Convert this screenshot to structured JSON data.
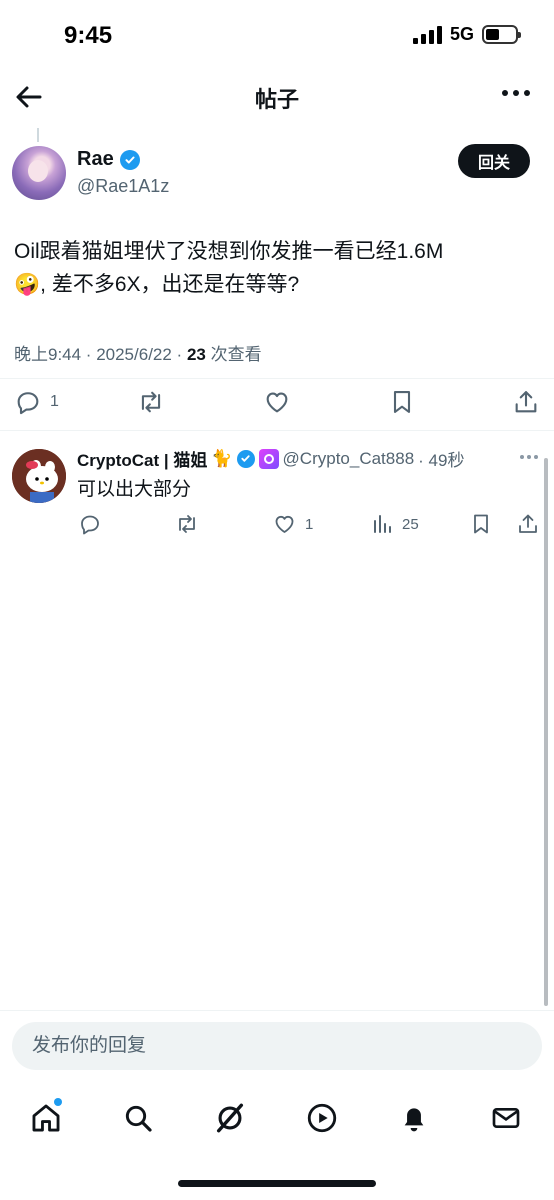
{
  "status_bar": {
    "time": "9:45",
    "network": "5G"
  },
  "header": {
    "title": "帖子",
    "back_icon": "back-arrow-icon",
    "more_icon": "more-horizontal-icon"
  },
  "post": {
    "author_name": "Rae",
    "author_handle": "@Rae1A1z",
    "follow_label": "回关",
    "text_line1": "Oil跟着猫姐埋伏了没想到你发推一看已经1.6M",
    "text_line2_emoji": "🤪",
    "text_line2": ", 差不多6X，出还是在等等?",
    "timestamp": "晚上9:44 · 2025/6/22 · ",
    "views_count": "23",
    "views_label": " 次查看",
    "reply_count": "1"
  },
  "reply": {
    "name": "CryptoCat | 猫姐",
    "name_emoji": "🐈",
    "handle": "@Crypto_Cat888",
    "time": "· 49秒",
    "text": "可以出大部分",
    "like_count": "1",
    "view_count": "25"
  },
  "composer": {
    "placeholder": "发布你的回复"
  },
  "nav": {
    "items": [
      "home-icon",
      "search-icon",
      "grok-icon",
      "video-icon",
      "notifications-icon",
      "messages-icon"
    ]
  },
  "colors": {
    "accent": "#1d9bf0",
    "text": "#0f1419",
    "muted": "#536471"
  }
}
